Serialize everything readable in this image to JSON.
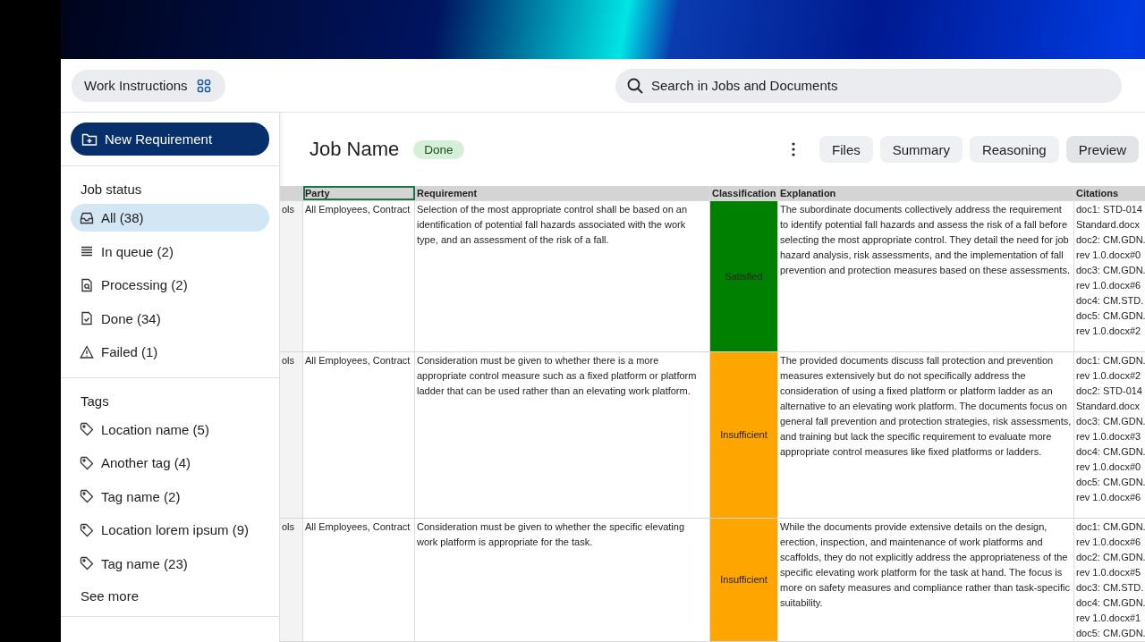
{
  "app": {
    "title": "Work Instructions"
  },
  "search": {
    "placeholder": "Search in Jobs and Documents"
  },
  "sidebar": {
    "new_button": "New Requirement",
    "status_heading": "Job status",
    "status_items": [
      {
        "label": "All (38)",
        "selected": true
      },
      {
        "label": "In queue (2)",
        "selected": false
      },
      {
        "label": "Processing (2)",
        "selected": false
      },
      {
        "label": "Done (34)",
        "selected": false
      },
      {
        "label": "Failed (1)",
        "selected": false
      }
    ],
    "tags_heading": "Tags",
    "tags": [
      {
        "label": "Location name (5)"
      },
      {
        "label": "Another tag (4)"
      },
      {
        "label": "Tag name (2)"
      },
      {
        "label": "Location lorem ipsum (9)"
      },
      {
        "label": "Tag name (23)"
      }
    ],
    "see_more": "See more"
  },
  "job": {
    "title": "Job Name",
    "status": "Done",
    "tabs": [
      {
        "label": "Files",
        "selected": false
      },
      {
        "label": "Summary",
        "selected": false
      },
      {
        "label": "Reasoning",
        "selected": false
      },
      {
        "label": "Preview",
        "selected": true
      }
    ]
  },
  "table": {
    "columns": [
      {
        "label": "Party",
        "selected": true
      },
      {
        "label": "Requirement",
        "selected": false
      },
      {
        "label": "Classification",
        "selected": false
      },
      {
        "label": "Explanation",
        "selected": false
      },
      {
        "label": "Citations",
        "selected": false
      }
    ],
    "rows": [
      {
        "column_1": "ols",
        "party": "All Employees, Contract",
        "requirement": "Selection of the most appropriate control shall be based on an identification of potential fall hazards associated with the work type, and an assessment of the risk of a fall.",
        "classification": "Satisfied",
        "color": "#008000",
        "explanation": "The subordinate documents collectively address the requirement to identify potential fall hazards and assess the risk of a fall before selecting the most appropriate control. They detail the need for job hazard analysis, risk assessments, and the implementation of fall prevention and protection measures based on these assessments.",
        "citations": [
          "doc1: STD-014",
          "Standard.docx",
          "doc2: CM.GDN.",
          "rev 1.0.docx#0",
          "doc3: CM.GDN.",
          "rev 1.0.docx#6",
          "doc4: CM.STD.",
          "doc5: CM.GDN.",
          "rev 1.0.docx#2"
        ]
      },
      {
        "column_1": "ols",
        "party": "All Employees, Contract",
        "requirement": "Consideration must be given to whether there is a more appropriate control measure such as a fixed platform or platform ladder that can be used rather than an elevating work platform.",
        "classification": "Insufficient",
        "color": "#ffa500",
        "explanation": "The provided documents discuss fall protection and prevention measures extensively but do not specifically address the consideration of using a fixed platform or platform ladder as an alternative to an elevating work platform. The documents focus on general fall prevention and protection strategies, risk assessments, and training but lack the specific requirement to evaluate more appropriate control measures like fixed platforms or ladders.",
        "citations": [
          "doc1: CM.GDN.",
          "rev 1.0.docx#2",
          "doc2: STD-014",
          "Standard.docx",
          "doc3: CM.GDN.",
          "rev 1.0.docx#3",
          "doc4: CM.GDN.",
          "rev 1.0.docx#0",
          "doc5: CM.GDN.",
          "rev 1.0.docx#6"
        ]
      },
      {
        "column_1": "ols",
        "party": "All Employees, Contract",
        "requirement": "Consideration must be given to whether the specific elevating work platform is appropriate for the task.",
        "classification": "Insufficient",
        "color": "#ffa500",
        "explanation": "While the documents provide extensive details on the design, erection, inspection, and maintenance of work platforms and scaffolds, they do not explicitly address the appropriateness of the specific elevating work platform for the task at hand. The focus is more on safety measures and compliance rather than task-specific suitability.",
        "citations": [
          "doc1: CM.GDN.",
          "rev 1.0.docx#6",
          "doc2: CM.GDN.",
          "rev 1.0.docx#5",
          "doc3: CM.STD.",
          "doc4: CM.GDN.",
          "rev 1.0.docx#1",
          "doc5: CM.GDN."
        ]
      }
    ]
  }
}
